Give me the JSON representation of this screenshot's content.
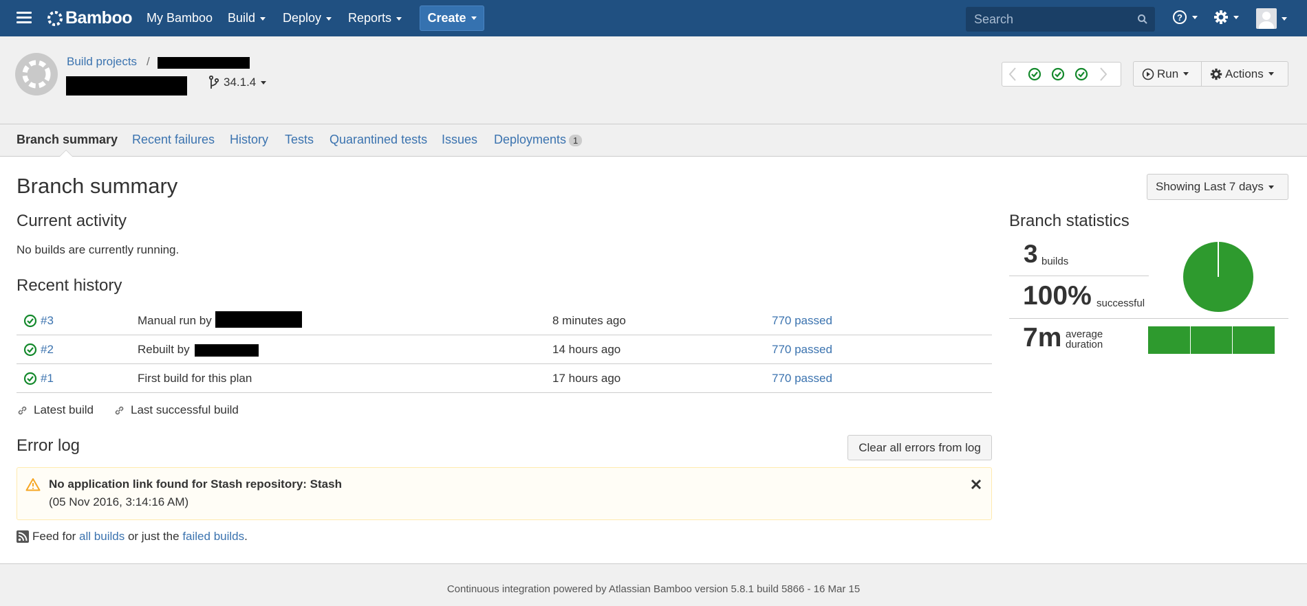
{
  "nav": {
    "brand": "Bamboo",
    "items": [
      {
        "label": "My Bamboo"
      },
      {
        "label": "Build"
      },
      {
        "label": "Deploy"
      },
      {
        "label": "Reports"
      }
    ],
    "create_label": "Create",
    "search_placeholder": "Search",
    "accent": "#205081"
  },
  "header": {
    "breadcrumb_root": "Build projects",
    "breadcrumb_sep": "/",
    "branch_label": "34.1.4",
    "run_label": "Run",
    "actions_label": "Actions"
  },
  "tabs": [
    {
      "label": "Branch summary",
      "active": true
    },
    {
      "label": "Recent failures"
    },
    {
      "label": "History"
    },
    {
      "label": "Tests"
    },
    {
      "label": "Quarantined tests"
    },
    {
      "label": "Issues"
    },
    {
      "label": "Deployments",
      "badge": "1"
    }
  ],
  "main": {
    "title": "Branch summary",
    "period_label": "Showing Last 7 days",
    "current_activity": {
      "heading": "Current activity",
      "text": "No builds are currently running."
    },
    "recent_history": {
      "heading": "Recent history",
      "rows": [
        {
          "build": "#3",
          "reason": "Manual run by",
          "time": "8 minutes ago",
          "result": "770 passed"
        },
        {
          "build": "#2",
          "reason": "Rebuilt by",
          "time": "14 hours ago",
          "result": "770 passed"
        },
        {
          "build": "#1",
          "reason": "First build for this plan",
          "time": "17 hours ago",
          "result": "770 passed"
        }
      ],
      "latest_link": "Latest build",
      "last_success_link": "Last successful build"
    },
    "error_log": {
      "heading": "Error log",
      "clear_label": "Clear all errors from log",
      "title": "No application link found for Stash repository: Stash",
      "time": "(05 Nov 2016, 3:14:16 AM)"
    },
    "feed": {
      "prefix": "Feed for",
      "all_link": "all builds",
      "middle": "or just the",
      "failed_link": "failed builds",
      "suffix": "."
    }
  },
  "stats": {
    "heading": "Branch statistics",
    "builds_value": "3",
    "builds_label": "builds",
    "success_value": "100%",
    "success_label": "successful",
    "duration_value": "7m",
    "duration_label_1": "average",
    "duration_label_2": "duration",
    "success_color": "#2e9a2e",
    "success_fraction": 1.0
  },
  "footer": {
    "text": "Continuous integration powered by Atlassian Bamboo version 5.8.1 build 5866 - 16 Mar 15"
  }
}
